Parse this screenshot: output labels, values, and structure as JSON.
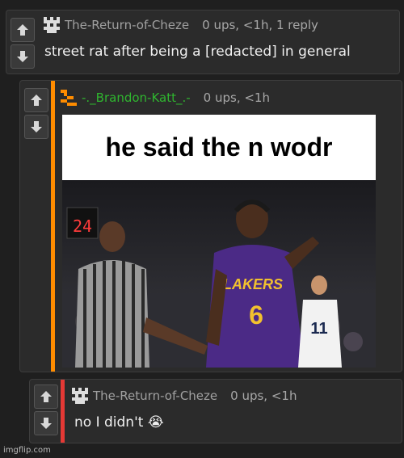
{
  "comments": [
    {
      "username": "The-Return-of-Cheze",
      "meta": "0 ups, <1h, 1 reply",
      "text": "street rat after being a [redacted] in general"
    },
    {
      "username": "-._Brandon-Katt_.-",
      "meta": "0 ups, <1h",
      "meme_caption": "he said the n wodr",
      "shot_clock": "24",
      "jersey_team": "LAKERS",
      "jersey_number": "6",
      "opponent_number": "11"
    },
    {
      "username": "The-Return-of-Cheze",
      "meta": "0 ups, <1h",
      "text": "no I didn't 😭"
    }
  ],
  "watermark": "imgflip.com",
  "colors": {
    "background": "#1f1f1f",
    "panel": "#2b2b2b",
    "reply_accent_orange": "#ff8c00",
    "reply_accent_red": "#e53935",
    "username_green": "#2fb52f"
  },
  "icons": {
    "upvote": "arrow-up-icon",
    "downvote": "arrow-down-icon",
    "avatar": "pixel-avatar-icon"
  }
}
